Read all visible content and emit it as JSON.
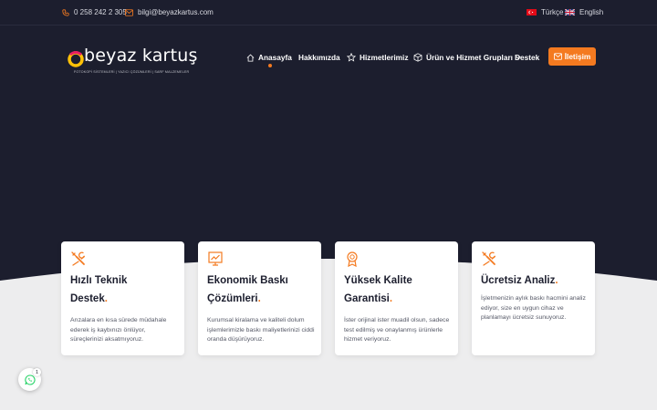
{
  "topbar": {
    "phone": "0 258 242 2 305",
    "email": "bilgi@beyazkartus.com",
    "lang_tr": "Türkçe",
    "lang_en": "English"
  },
  "logo": {
    "name": "beyaz kartuş",
    "tagline": "FOTOKOPİ SİSTEMLERİ | YAZICI ÇÖZÜMLERİ | SARF MALZEMELER"
  },
  "nav": {
    "home": "Anasayfa",
    "about": "Hakkımızda",
    "services": "Hizmetlerimiz",
    "products": "Ürün ve Hizmet Grupları",
    "support": "Destek",
    "contact": "İletişim"
  },
  "cards": [
    {
      "icon": "tools-icon",
      "title_line1": "Hızlı Teknik",
      "title_line2": "Destek",
      "dot": ".",
      "desc": "Arızalara en kısa sürede müdahale ederek iş kaybınızı önlüyor, süreçlerinizi aksatmıyoruz."
    },
    {
      "icon": "chart-icon",
      "title_line1": "Ekonomik Baskı",
      "title_line2": "Çözümleri",
      "dot": ".",
      "desc": "Kurumsal kiralama ve kaliteli dolum işlemlerimizle baskı maliyetlerinizi ciddi oranda düşürüyoruz."
    },
    {
      "icon": "award-icon",
      "title_line1": "Yüksek Kalite",
      "title_line2": "Garantisi",
      "dot": ".",
      "desc": "İster orijinal ister muadil olsun, sadece test edilmiş ve onaylanmış ürünlerle hizmet veriyoruz."
    },
    {
      "icon": "tools-icon",
      "title_line1": "Ücretsiz Analiz",
      "title_line2": "",
      "dot": ".",
      "desc": "İşletmenizin aylık baskı hacmini analiz ediyor, size en uygun cihaz ve planlamayı ücretsiz sunuyoruz."
    }
  ],
  "whatsapp": {
    "badge": "1"
  },
  "colors": {
    "accent": "#f47a20",
    "dark": "#1c1e2e",
    "light_bg": "#ededee"
  }
}
